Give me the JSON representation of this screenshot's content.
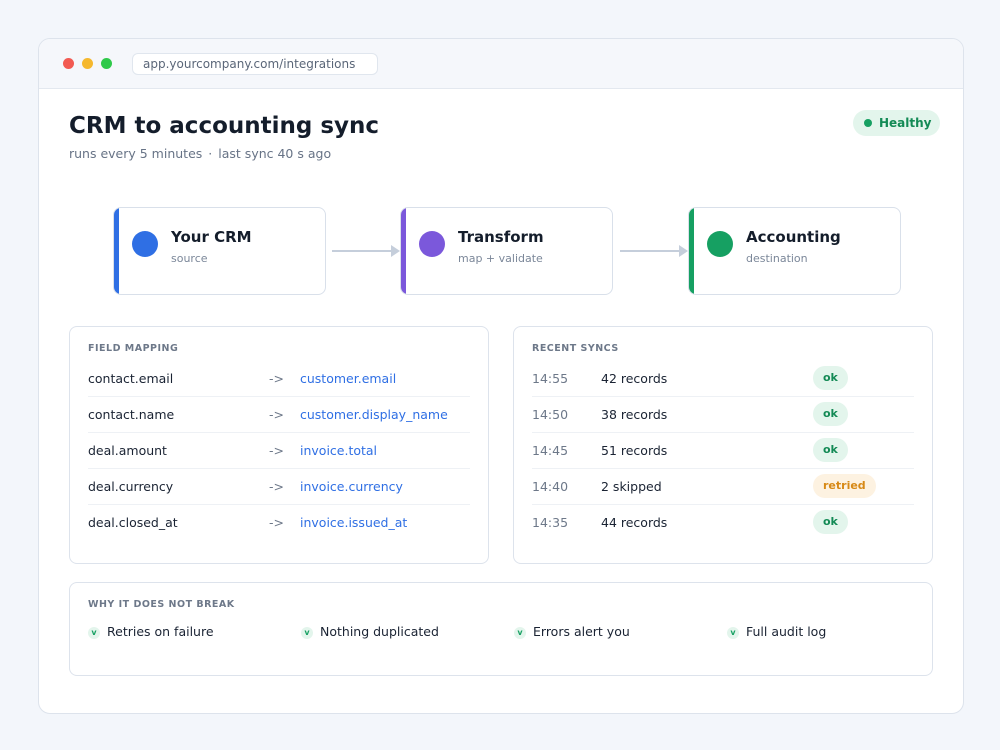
{
  "browser": {
    "url": "app.yourcompany.com/integrations"
  },
  "header": {
    "title": "CRM to accounting sync",
    "schedule": "runs every 5 minutes",
    "separator": "·",
    "last_sync": "last sync 40 s ago",
    "status": "Healthy"
  },
  "pipeline": {
    "nodes": [
      {
        "name": "Your CRM",
        "role": "source",
        "color": "#2f6fe4"
      },
      {
        "name": "Transform",
        "role": "map + validate",
        "color": "#7b58db"
      },
      {
        "name": "Accounting",
        "role": "destination",
        "color": "#16a062"
      }
    ]
  },
  "mapping": {
    "title": "FIELD MAPPING",
    "arrow": "->",
    "rows": [
      {
        "source": "contact.email",
        "target": "customer.email"
      },
      {
        "source": "contact.name",
        "target": "customer.display_name"
      },
      {
        "source": "deal.amount",
        "target": "invoice.total"
      },
      {
        "source": "deal.currency",
        "target": "invoice.currency"
      },
      {
        "source": "deal.closed_at",
        "target": "invoice.issued_at"
      }
    ]
  },
  "syncs": {
    "title": "RECENT SYNCS",
    "rows": [
      {
        "time": "14:55",
        "desc": "42 records",
        "status": "ok"
      },
      {
        "time": "14:50",
        "desc": "38 records",
        "status": "ok"
      },
      {
        "time": "14:45",
        "desc": "51 records",
        "status": "ok"
      },
      {
        "time": "14:40",
        "desc": "2 skipped",
        "status": "retried"
      },
      {
        "time": "14:35",
        "desc": "44 records",
        "status": "ok"
      }
    ]
  },
  "guarantees": {
    "title": "WHY IT DOES NOT BREAK",
    "check_glyph": "v",
    "items": [
      "Retries on failure",
      "Nothing duplicated",
      "Errors alert you",
      "Full audit log"
    ]
  }
}
